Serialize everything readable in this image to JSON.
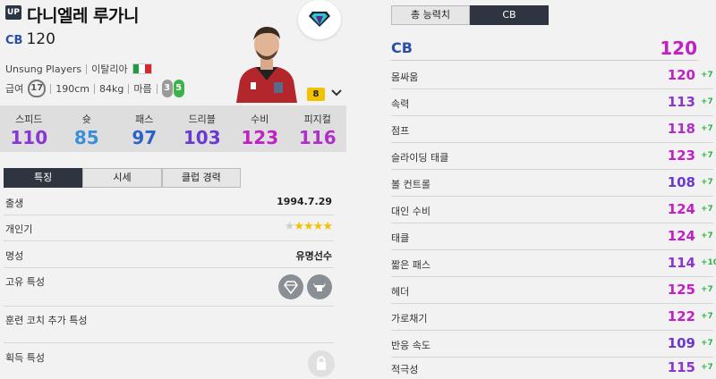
{
  "player": {
    "badge": "UP",
    "name": "다니엘레 루가니",
    "position": "CB",
    "overall": "120",
    "club": "Unsung Players",
    "nation": "이탈리아",
    "salary_label": "급여",
    "salary": "17",
    "height": "190cm",
    "weight": "84kg",
    "body": "마름",
    "foot_left": "3",
    "foot_right": "5",
    "level": "8"
  },
  "summary_stats": [
    {
      "label": "스피드",
      "value": "110",
      "color": "#8a35d6"
    },
    {
      "label": "슛",
      "value": "85",
      "color": "#3a8fd8"
    },
    {
      "label": "패스",
      "value": "97",
      "color": "#2b63c9"
    },
    {
      "label": "드리블",
      "value": "103",
      "color": "#6a3ad0"
    },
    {
      "label": "수비",
      "value": "123",
      "color": "#c21fc7"
    },
    {
      "label": "피지컬",
      "value": "116",
      "color": "#b02fc9"
    }
  ],
  "left_tabs": [
    "특징",
    "시세",
    "클럽 경력"
  ],
  "attributes": {
    "birth_label": "출생",
    "birth": "1994.7.29",
    "popularity_label": "개인기",
    "fame_label": "명성",
    "fame": "유명선수",
    "unique_traits_label": "고유 특성",
    "coach_traits_label": "훈련 코치 추가 특성",
    "acquired_traits_label": "획득 특성"
  },
  "right_tabs": [
    "총 능력치",
    "CB"
  ],
  "cb_header": {
    "label": "CB",
    "value": "120"
  },
  "detail_stats": [
    {
      "label": "몸싸움",
      "value": "120",
      "bonus": "+7",
      "color": "#c21fc7"
    },
    {
      "label": "속력",
      "value": "113",
      "bonus": "+7",
      "color": "#8a35d6"
    },
    {
      "label": "점프",
      "value": "118",
      "bonus": "+7",
      "color": "#b02fc9"
    },
    {
      "label": "슬라이딩 태클",
      "value": "123",
      "bonus": "+7",
      "color": "#c21fc7"
    },
    {
      "label": "볼 컨트롤",
      "value": "108",
      "bonus": "+7",
      "color": "#6a3ad0"
    },
    {
      "label": "대인 수비",
      "value": "124",
      "bonus": "+7",
      "color": "#c21fc7"
    },
    {
      "label": "태클",
      "value": "124",
      "bonus": "+7",
      "color": "#c21fc7"
    },
    {
      "label": "짧은 패스",
      "value": "114",
      "bonus": "+10",
      "color": "#8a35d6"
    },
    {
      "label": "헤더",
      "value": "125",
      "bonus": "+7",
      "color": "#c21fc7"
    },
    {
      "label": "가로채기",
      "value": "122",
      "bonus": "+7",
      "color": "#c21fc7"
    },
    {
      "label": "반응 속도",
      "value": "109",
      "bonus": "+7",
      "color": "#6a3ad0"
    },
    {
      "label": "적극성",
      "value": "115",
      "bonus": "+7",
      "color": "#8a35d6"
    }
  ]
}
